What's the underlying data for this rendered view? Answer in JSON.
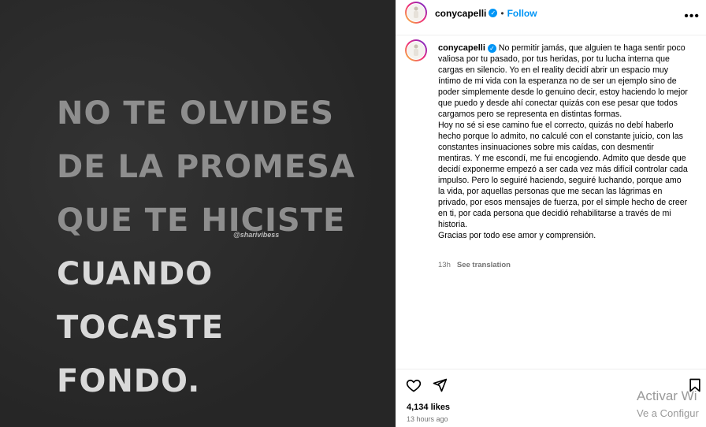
{
  "image": {
    "quote_lines": [
      "NO TE OLVIDES",
      "DE LA PROMESA",
      "QUE TE HICISTE",
      "CUANDO",
      "TOCASTE",
      "FONDO."
    ],
    "watermark": "@sharivibess"
  },
  "header": {
    "username": "conycapelli",
    "follow_label": "Follow",
    "separator": "•",
    "more": "•••"
  },
  "caption": {
    "username": "conycapelli",
    "paragraphs": [
      "No permitir jamás, que alguien te haga sentir poco valiosa por tu pasado, por tus heridas, por tu lucha interna que cargas en silencio. Yo en el reality decidí abrir un espacio muy íntimo de mi vida con la esperanza no de ser un ejemplo sino de poder simplemente desde lo genuino decir, estoy haciendo lo mejor que puedo y desde ahí conectar quizás con ese pesar que todos cargamos pero se representa en distintas formas.",
      "Hoy no sé si ese camino fue el correcto, quizás no debí haberlo hecho porque lo admito, no calculé con el constante juicio, con las constantes insinuaciones sobre mis caídas, con desmentir mentiras. Y me escondí, me fui encogiendo. Admito que desde que decidí exponerme empezó a ser cada vez más difícil controlar cada impulso. Pero lo seguiré haciendo, seguiré luchando, porque amo la vida, por aquellas personas que me secan las lágrimas en privado, por esos mensajes de fuerza, por el simple hecho de creer en ti, por cada persona que decidió rehabilitarse a través de mi historia.",
      "Gracias por todo ese amor y comprensión."
    ],
    "age": "13h",
    "see_translation": "See translation"
  },
  "footer": {
    "likes": "4,134 likes",
    "time": "13 hours ago",
    "icons": [
      "heart-icon",
      "share-icon",
      "bookmark-icon"
    ]
  },
  "os_watermark": {
    "line1": "Activar Wi",
    "line2": "Ve a Configur"
  },
  "colors": {
    "accent": "#0095f6",
    "muted": "#737373",
    "image_bg": "#2b2b2b"
  }
}
